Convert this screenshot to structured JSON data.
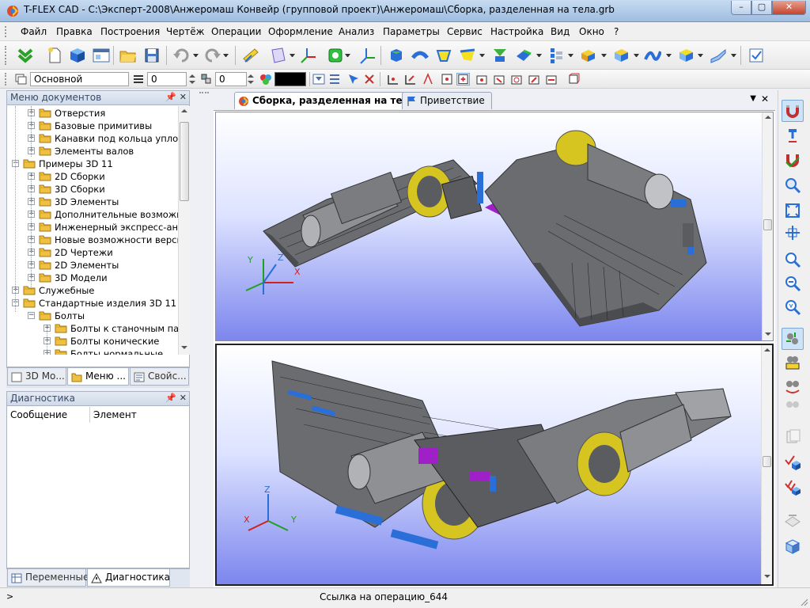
{
  "window": {
    "title": "T-FLEX CAD - C:\\Эксперт-2008\\Анжеромаш Конвейр (групповой проект)\\Анжеромаш\\Сборка, разделенная на тела.grb",
    "buttons": {
      "minimize": "–",
      "maximize": "▢",
      "close": "✕"
    }
  },
  "menu": {
    "items": [
      "Файл",
      "Правка",
      "Построения",
      "Чертёж",
      "Операции",
      "Оформление",
      "Анализ",
      "Параметры",
      "Сервис",
      "Настройка",
      "Вид",
      "Окно",
      "?"
    ]
  },
  "toolbar2": {
    "layer": "Основной",
    "width_value": "0",
    "level_value": "0",
    "color_swatch": "#000000"
  },
  "menu_panel": {
    "title": "Меню документов",
    "tree": [
      {
        "label": "Отверстия",
        "level": 2,
        "exp": "+"
      },
      {
        "label": "Базовые примитивы",
        "level": 2,
        "exp": "+"
      },
      {
        "label": "Канавки под кольца уплотнит",
        "level": 2,
        "exp": "+"
      },
      {
        "label": "Элементы валов",
        "level": 2,
        "exp": "+"
      },
      {
        "label": "Примеры 3D 11",
        "level": 1,
        "exp": "−"
      },
      {
        "label": "2D Сборки",
        "level": 2,
        "exp": "+"
      },
      {
        "label": "3D Сборки",
        "level": 2,
        "exp": "+"
      },
      {
        "label": "3D Элементы",
        "level": 2,
        "exp": "+"
      },
      {
        "label": "Дополнительные возможно...",
        "level": 2,
        "exp": "+"
      },
      {
        "label": "Инженерный экспресс-ана...",
        "level": 2,
        "exp": "+"
      },
      {
        "label": "Новые возможности версии...",
        "level": 2,
        "exp": "+"
      },
      {
        "label": "2D Чертежи",
        "level": 2,
        "exp": "+"
      },
      {
        "label": "2D Элементы",
        "level": 2,
        "exp": "+"
      },
      {
        "label": "3D Модели",
        "level": 2,
        "exp": "+"
      },
      {
        "label": "Служебные",
        "level": 1,
        "exp": "+"
      },
      {
        "label": "Стандартные изделия 3D 11",
        "level": 1,
        "exp": "−"
      },
      {
        "label": "Болты",
        "level": 2,
        "exp": "−"
      },
      {
        "label": "Болты к станочным паз...",
        "level": 3,
        "exp": "+"
      },
      {
        "label": "Болты конические",
        "level": 3,
        "exp": "+"
      },
      {
        "label": "Болты нормальные",
        "level": 3,
        "exp": "+"
      }
    ],
    "tabs": [
      "3D Мо...",
      "Меню ...",
      "Свойс..."
    ],
    "active_tab": 1
  },
  "diag_panel": {
    "title": "Диагностика",
    "columns": [
      "Сообщение",
      "Элемент"
    ],
    "tabs": [
      "Переменные",
      "Диагностика"
    ]
  },
  "document": {
    "tabs": [
      "Сборка, разделенная на тела.grb",
      "Приветствие"
    ],
    "close_symbols": {
      "list": "▼",
      "close": "✕"
    },
    "axes_top": {
      "y": "Y",
      "z": "Z",
      "x": "X"
    },
    "axes_bottom": {
      "z": "Z",
      "x": "X",
      "y": "Y"
    }
  },
  "status": {
    "left": ">",
    "center": "Ссылка на операцию_644"
  },
  "colors": {
    "accent": "#3c6fb0",
    "model_yellow": "#d6c420",
    "model_purple": "#a020c8",
    "model_blue": "#2a6fd8"
  }
}
